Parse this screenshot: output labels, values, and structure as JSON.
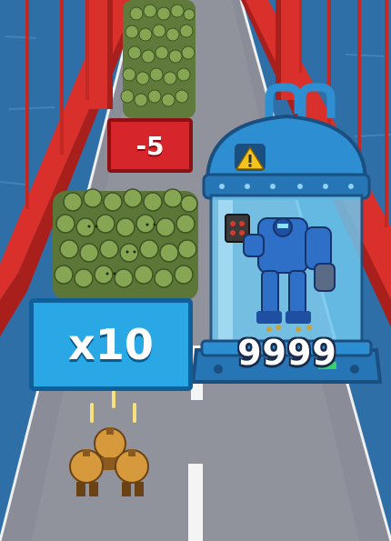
{
  "gates": {
    "minus_label": "-5",
    "multiply_label": "x10"
  },
  "boss": {
    "health": "9999"
  },
  "colors": {
    "water": "#2f6fa8",
    "road": "#8a8c97",
    "bridge_red": "#d9302c",
    "gate_red": "#d7262b",
    "gate_blue": "#2aa8e6",
    "zombie_green": "#7f9d4f",
    "capsule_blue": "#2d8fd2"
  },
  "icons": [
    "warning-icon",
    "zombie-icon",
    "soldier-icon",
    "mech-icon",
    "bullet-icon"
  ]
}
